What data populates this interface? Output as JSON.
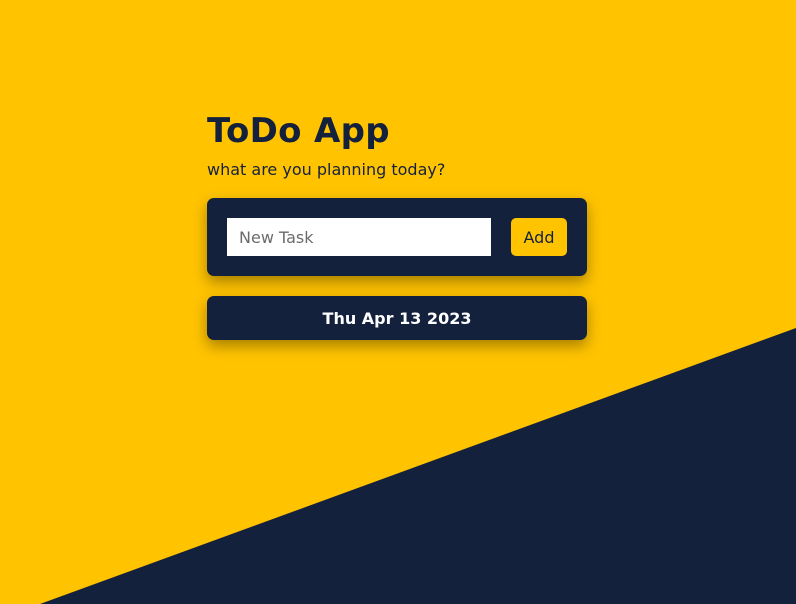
{
  "app": {
    "title": "ToDo App",
    "subtitle": "what are you planning today?"
  },
  "form": {
    "input_value": "",
    "input_placeholder": "New Task",
    "add_label": "Add"
  },
  "date": {
    "text": "Thu Apr 13 2023"
  },
  "colors": {
    "background": "#ffc300",
    "accent": "#ffc300",
    "dark": "#14213d",
    "input_background": "#ffffff"
  }
}
